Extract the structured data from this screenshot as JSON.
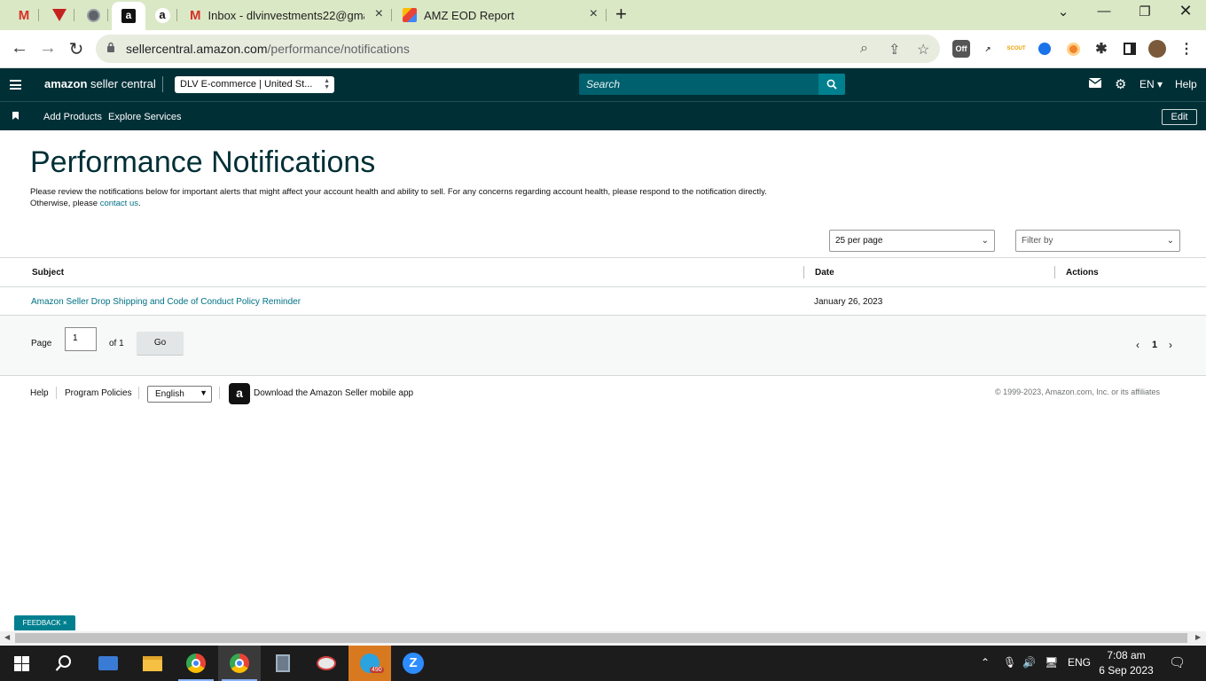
{
  "browser": {
    "tabs": [
      {
        "title": "Inbox - dlvinvestments22@gmail",
        "icon": "gmail-icon"
      },
      {
        "title": "AMZ EOD Report",
        "icon": "sheets-icon"
      }
    ],
    "url_host": "sellercentral.amazon.com",
    "url_path": "/performance/notifications",
    "extensions": {
      "off_badge": "Off",
      "scout_label": "SCOUT"
    }
  },
  "header": {
    "logo_bold": "amazon",
    "logo_rest": " seller central",
    "account_selector": "DLV E-commerce | United St...",
    "search_placeholder": "Search",
    "lang": "EN ▾",
    "help": "Help"
  },
  "subnav": {
    "items": [
      "Add Products",
      "Explore Services"
    ],
    "edit": "Edit"
  },
  "page": {
    "title": "Performance Notifications",
    "desc_line1": "Please review the notifications below for important alerts that might affect your account health and ability to sell. For any concerns regarding account health, please respond to the notification directly.",
    "desc_line2_prefix": "Otherwise, please ",
    "desc_link": "contact us",
    "desc_suffix": ".",
    "per_page": "25 per page",
    "filter": "Filter by"
  },
  "table": {
    "columns": [
      "Subject",
      "Date",
      "Actions"
    ],
    "rows": [
      {
        "subject": "Amazon Seller Drop Shipping and Code of Conduct Policy Reminder",
        "date": "January 26, 2023",
        "actions": ""
      }
    ]
  },
  "pager": {
    "page_label": "Page",
    "page_value": "1",
    "of_label": "of 1",
    "go": "Go",
    "prev": "‹",
    "current": "1",
    "next": "›"
  },
  "footer": {
    "help": "Help",
    "program_policies": "Program Policies",
    "language": "English",
    "app_text": "Download the Amazon Seller mobile app",
    "copyright": "© 1999-2023, Amazon.com, Inc. or its affiliates"
  },
  "feedback": "FEEDBACK ×",
  "taskbar": {
    "telegram_badge": "490",
    "lang": "ENG",
    "time": "7:08 am",
    "date": "6 Sep 2023"
  },
  "colors": {
    "header_bg": "#002f36",
    "accent": "#00808f",
    "link": "#007185",
    "tabstrip": "#dbe8c6"
  }
}
